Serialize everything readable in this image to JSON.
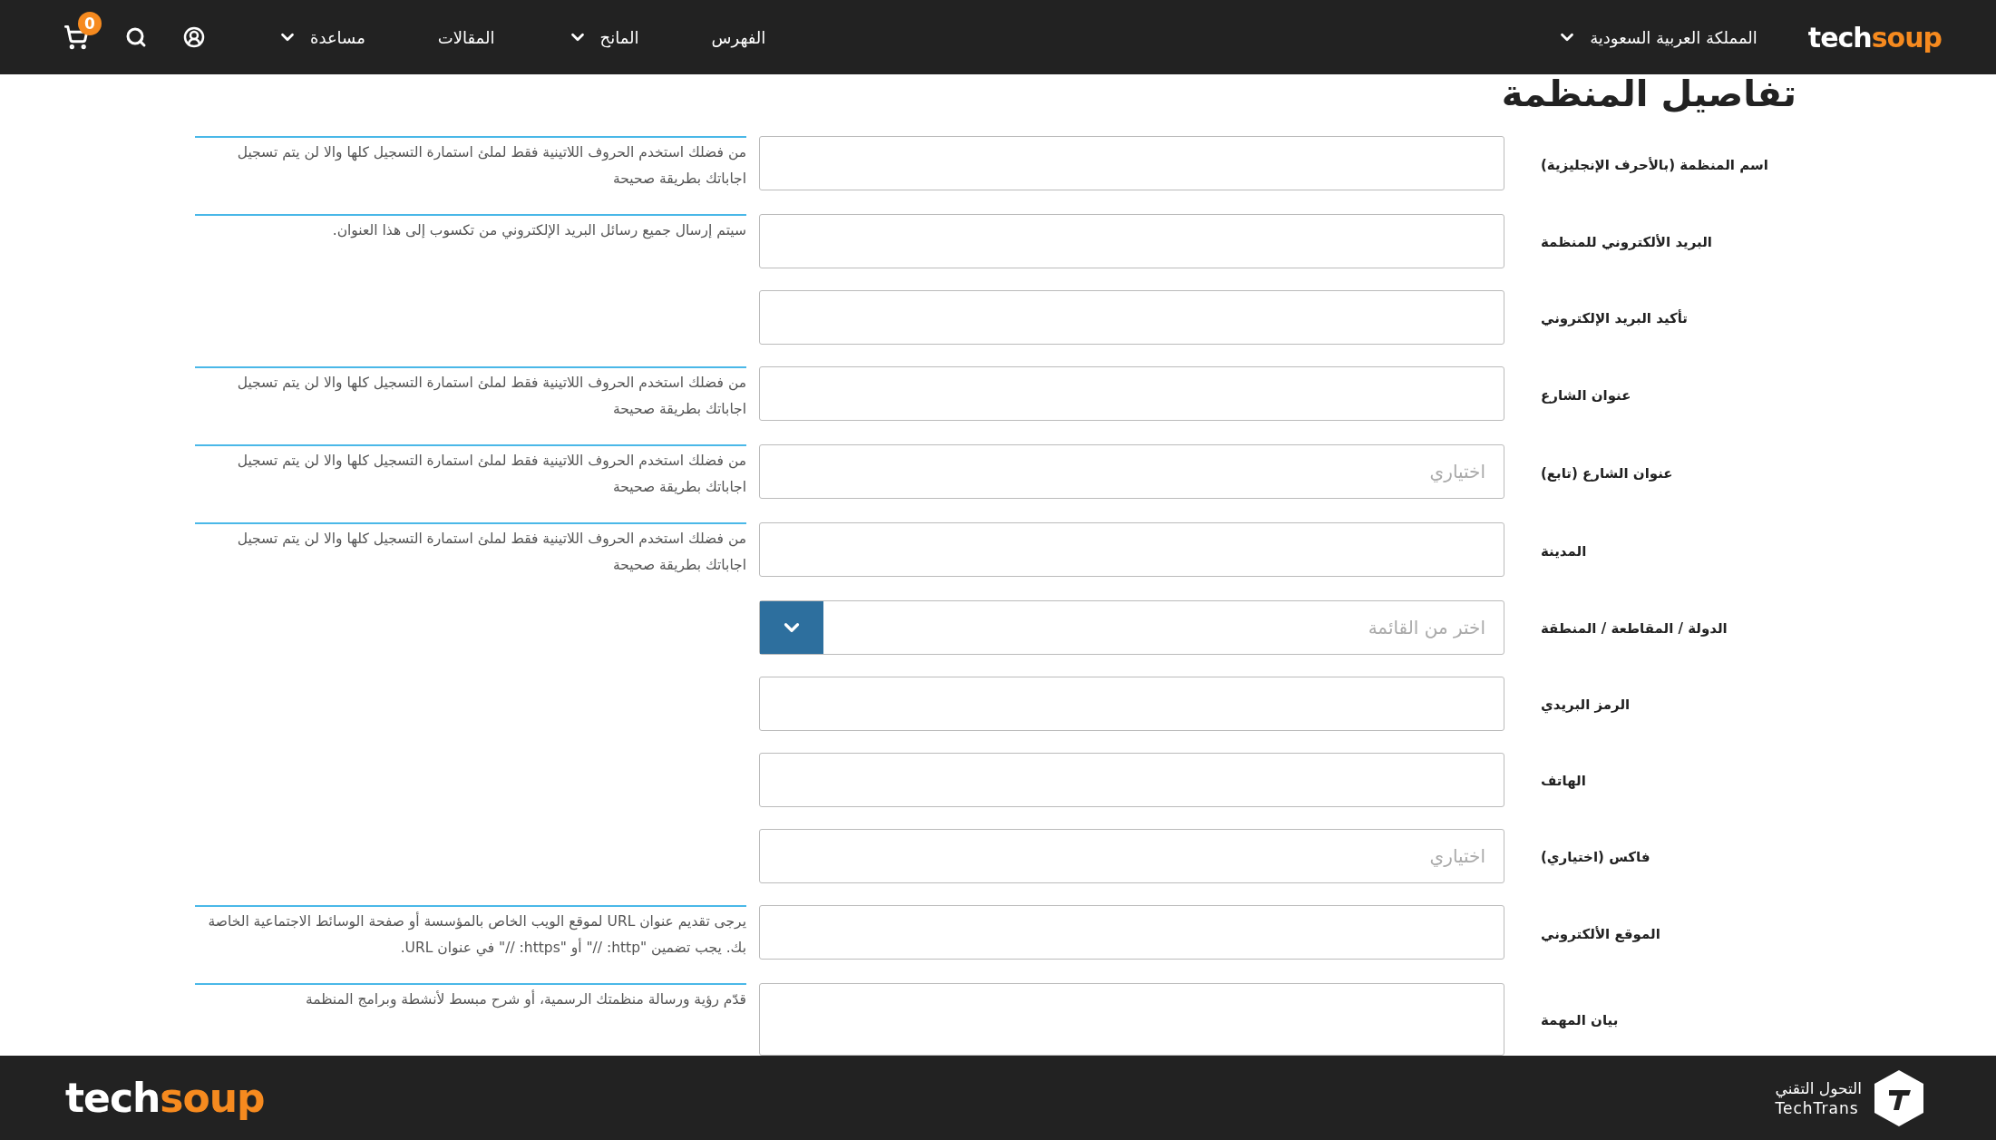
{
  "header": {
    "logo": {
      "part_1": "tech",
      "part_2": "soup"
    },
    "country": "المملكة العربية السعودية",
    "nav": [
      {
        "label": "الفهرس",
        "dropdown": false
      },
      {
        "label": "المانح",
        "dropdown": true
      },
      {
        "label": "المقالات",
        "dropdown": false
      },
      {
        "label": "مساعدة",
        "dropdown": true
      }
    ],
    "cart_count": "0"
  },
  "form": {
    "title": "تفاصيل المنظمة",
    "rows": [
      {
        "label": "اسم المنظمة (بالأحرف الإنجليزية)",
        "kind": "text",
        "help": "من فضلك استخدم الحروف اللاتينية فقط لملئ استمارة التسجيل كلها والا لن يتم تسجيل اجاباتك بطريقة صحيحة"
      },
      {
        "label": "البريد الألكتروني للمنظمة",
        "kind": "text",
        "help": "سيتم إرسال جميع رسائل البريد الإلكتروني من تكسوب إلى هذا العنوان."
      },
      {
        "label": "تأكيد البريد الإلكتروني",
        "kind": "text"
      },
      {
        "label": "عنوان الشارع",
        "kind": "text",
        "help": "من فضلك استخدم الحروف اللاتينية فقط لملئ استمارة التسجيل كلها والا لن يتم تسجيل اجاباتك بطريقة صحيحة"
      },
      {
        "label": "عنوان الشارع (تابع)",
        "kind": "text",
        "placeholder": "اختياري",
        "help": "من فضلك استخدم الحروف اللاتينية فقط لملئ استمارة التسجيل كلها والا لن يتم تسجيل اجاباتك بطريقة صحيحة"
      },
      {
        "label": "المدينة",
        "kind": "text",
        "help": "من فضلك استخدم الحروف اللاتينية فقط لملئ استمارة التسجيل كلها والا لن يتم تسجيل اجاباتك بطريقة صحيحة"
      },
      {
        "label": "الدولة / المقاطعة / المنطقة",
        "kind": "select",
        "placeholder": "اختر من القائمة"
      },
      {
        "label": "الرمز البريدي",
        "kind": "text"
      },
      {
        "label": "الهاتف",
        "kind": "text"
      },
      {
        "label": "فاكس (اختياري)",
        "kind": "text",
        "placeholder": "اختياري"
      },
      {
        "label": "الموقع الألكتروني",
        "kind": "text",
        "help": "يرجى تقديم عنوان URL لموقع الويب الخاص بالمؤسسة أو صفحة الوسائط الاجتماعية الخاصة بك. يجب تضمين \"http: //\" أو \"https: //\" في عنوان URL."
      },
      {
        "label": "بيان المهمة",
        "kind": "textarea",
        "help": "قدّم رؤية ورسالة منظمتك الرسمية، أو شرح مبسط لأنشطة وبرامج المنظمة"
      }
    ]
  },
  "footer": {
    "logo": {
      "part_1": "tech",
      "part_2": "soup"
    },
    "partner": {
      "arabic": "التحول التقني",
      "latin": "TechTrans"
    }
  }
}
